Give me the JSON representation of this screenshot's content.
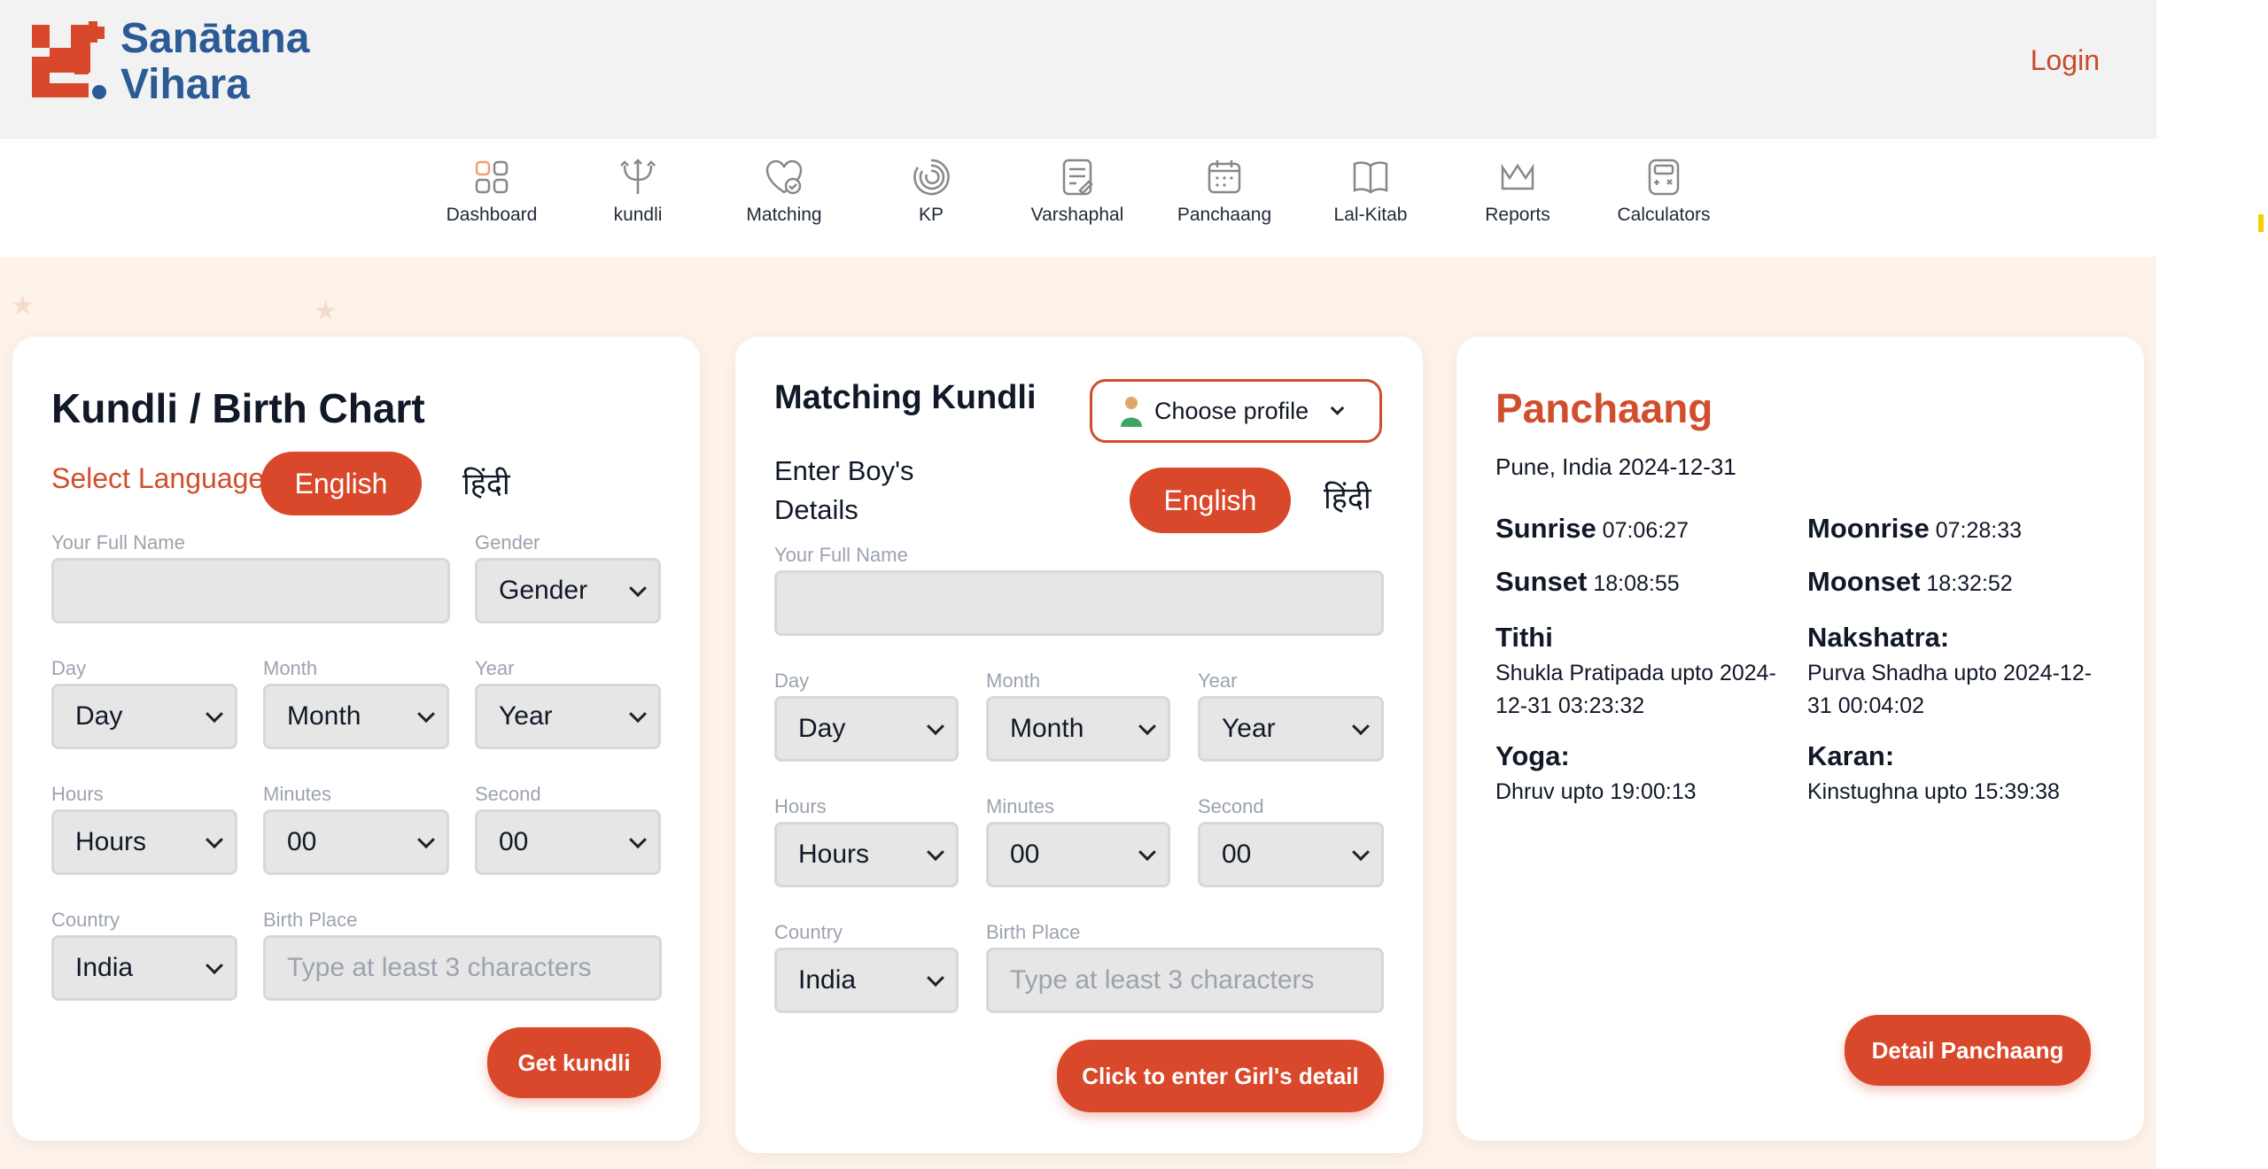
{
  "header": {
    "logo_line1": "Sanātana",
    "logo_line2": "Vihara",
    "login": "Login"
  },
  "nav": [
    {
      "label": "Dashboard",
      "icon": "dashboard-icon"
    },
    {
      "label": "kundli",
      "icon": "trident-icon"
    },
    {
      "label": "Matching",
      "icon": "heart-check-icon"
    },
    {
      "label": "KP",
      "icon": "spiral-icon"
    },
    {
      "label": "Varshaphal",
      "icon": "document-edit-icon"
    },
    {
      "label": "Panchaang",
      "icon": "calendar-icon"
    },
    {
      "label": "Lal-Kitab",
      "icon": "book-icon"
    },
    {
      "label": "Reports",
      "icon": "crown-icon"
    },
    {
      "label": "Calculators",
      "icon": "calculator-icon"
    }
  ],
  "kundli": {
    "title": "Kundli / Birth Chart",
    "select_language": "Select Language",
    "english": "English",
    "hindi": "हिंदी",
    "labels": {
      "full_name": "Your Full Name",
      "gender": "Gender",
      "day": "Day",
      "month": "Month",
      "year": "Year",
      "hours": "Hours",
      "minutes": "Minutes",
      "second": "Second",
      "country": "Country",
      "birth_place": "Birth Place"
    },
    "values": {
      "gender": "Gender",
      "day": "Day",
      "month": "Month",
      "year": "Year",
      "hours": "Hours",
      "minutes": "00",
      "second": "00",
      "country": "India"
    },
    "birth_place_placeholder": "Type at least 3 characters",
    "submit": "Get kundli"
  },
  "matching": {
    "title": "Matching Kundli",
    "choose_profile": "Choose profile",
    "sub_label": "Enter Boy's Details",
    "english": "English",
    "hindi": "हिंदी",
    "labels": {
      "full_name": "Your Full Name",
      "day": "Day",
      "month": "Month",
      "year": "Year",
      "hours": "Hours",
      "minutes": "Minutes",
      "second": "Second",
      "country": "Country",
      "birth_place": "Birth Place"
    },
    "values": {
      "day": "Day",
      "month": "Month",
      "year": "Year",
      "hours": "Hours",
      "minutes": "00",
      "second": "00",
      "country": "India"
    },
    "birth_place_placeholder": "Type at least 3 characters",
    "submit": "Click to enter Girl's detail"
  },
  "panchaang": {
    "title": "Panchaang",
    "location_date": "Pune, India 2024-12-31",
    "sunrise_label": "Sunrise",
    "sunrise": "07:06:27",
    "moonrise_label": "Moonrise",
    "moonrise": "07:28:33",
    "sunset_label": "Sunset",
    "sunset": "18:08:55",
    "moonset_label": "Moonset",
    "moonset": "18:32:52",
    "tithi_label": "Tithi",
    "tithi": "Shukla Pratipada upto 2024-12-31 03:23:32",
    "nakshatra_label": "Nakshatra:",
    "nakshatra": "Purva Shadha upto 2024-12-31 00:04:02",
    "yoga_label": "Yoga:",
    "yoga": "Dhruv upto 19:00:13",
    "karan_label": "Karan:",
    "karan": "Kinstughna upto 15:39:38",
    "detail_button": "Detail Panchaang"
  },
  "colors": {
    "accent": "#d9482a",
    "brand_blue": "#2b5a96",
    "header_bg": "#f2f2f2",
    "content_bg": "#fdf3ea"
  }
}
